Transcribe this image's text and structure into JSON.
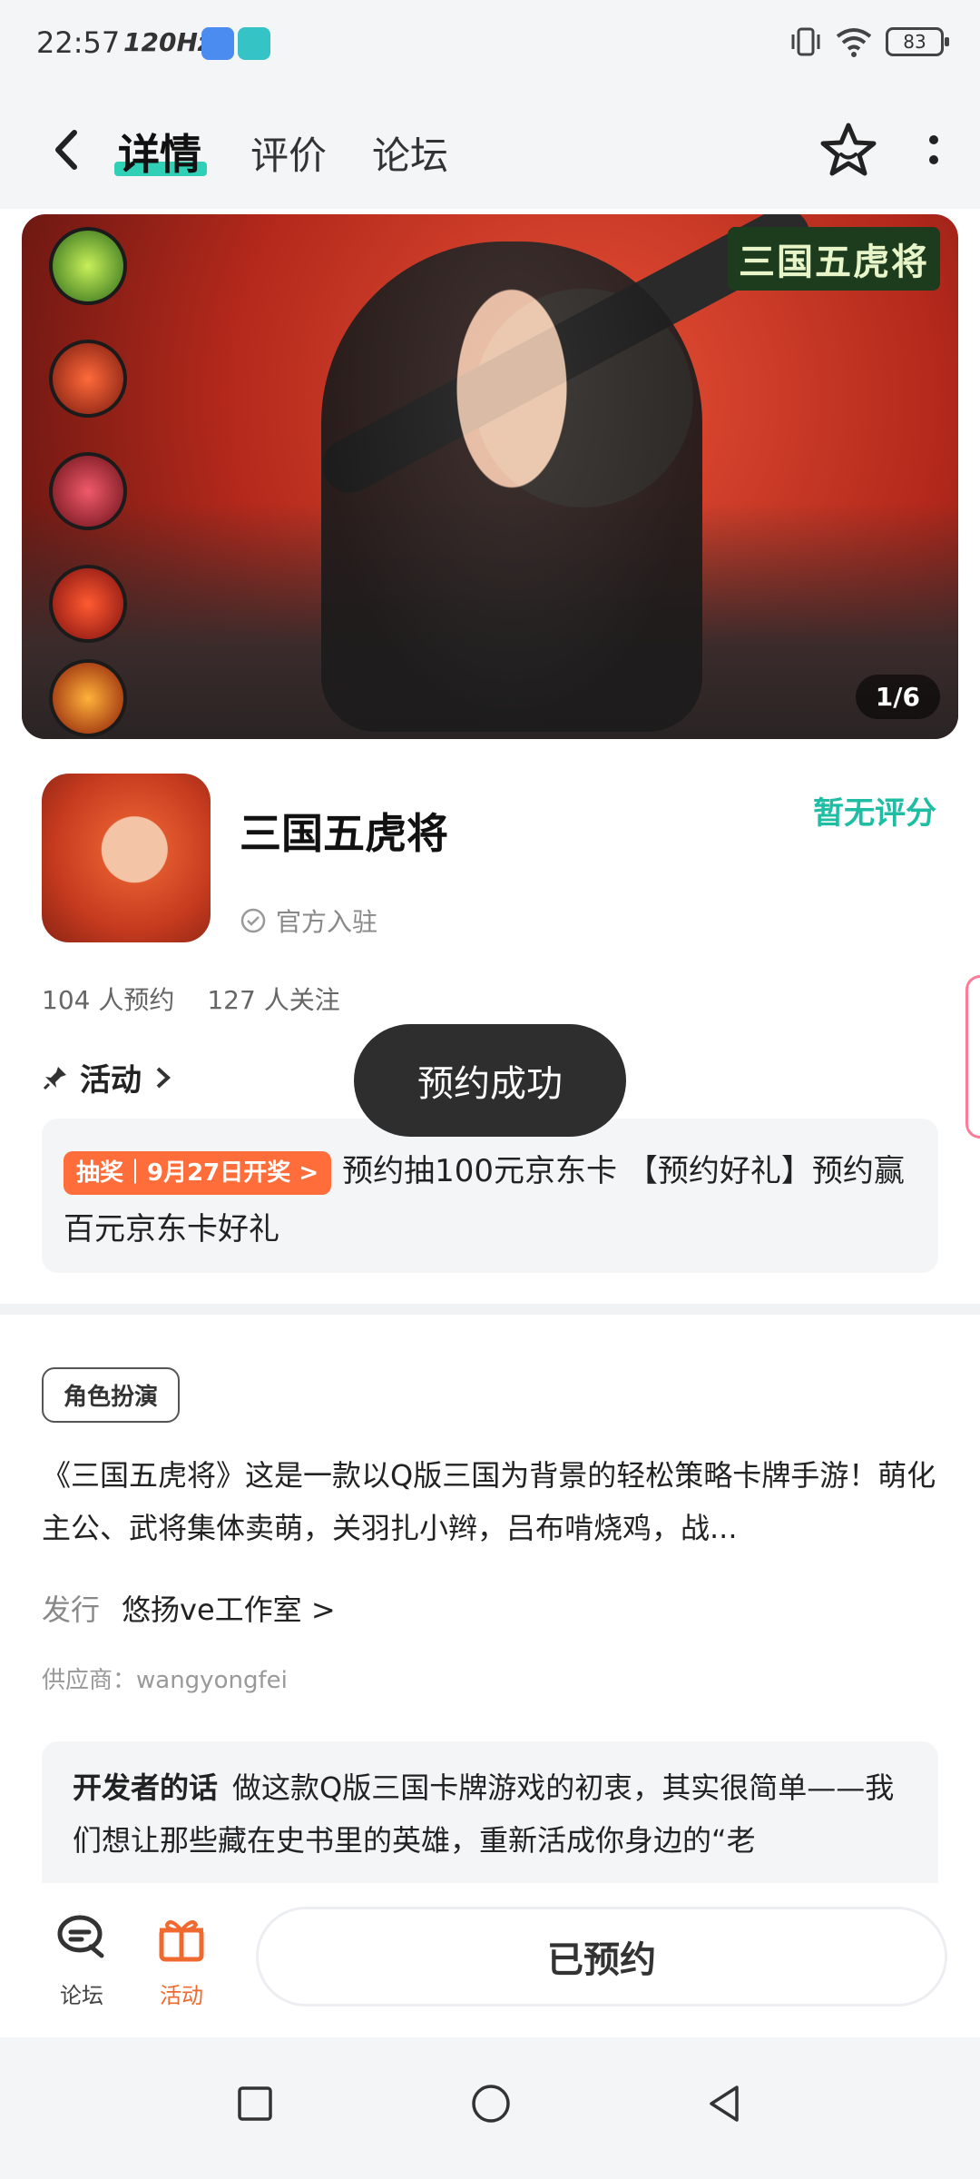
{
  "status_bar": {
    "time": "22:57",
    "refresh_rate": "120Hz",
    "battery": "83"
  },
  "nav": {
    "tabs": [
      "详情",
      "评价",
      "论坛"
    ],
    "active_tab": "详情"
  },
  "banner": {
    "logo_text": "三国五虎将",
    "counter": "1/6"
  },
  "app": {
    "name": "三国五虎将",
    "official": "官方入驻",
    "rating": "暂无评分",
    "reservations": "104 人预约",
    "followers": "127 人关注"
  },
  "activity": {
    "title": "活动",
    "badge": "抽奖｜9月27日开奖 >",
    "text": "预约抽100元京东卡 【预约好礼】预约赢百元京东卡好礼"
  },
  "toast": "预约成功",
  "details": {
    "tag": "角色扮演",
    "description": "《三国五虎将》这是一款以Q版三国为背景的轻松策略卡牌手游！萌化主公、武将集体卖萌，关羽扎小辫，吕布啃烧鸡，战...",
    "publisher_label": "发行",
    "publisher_name": "悠扬ve工作室 >",
    "supplier": "供应商：wangyongfei"
  },
  "developer": {
    "title": "开发者的话",
    "text": "做这款Q版三国卡牌游戏的初衷，其实很简单——我们想让那些藏在史书里的英雄，重新活成你身边的“老"
  },
  "bottom_bar": {
    "forum_label": "论坛",
    "activity_label": "活动",
    "button_label": "已预约",
    "accent": "#f06a2f"
  },
  "colors": {
    "teal": "#1fbea4",
    "orange": "#ff6d3a"
  }
}
